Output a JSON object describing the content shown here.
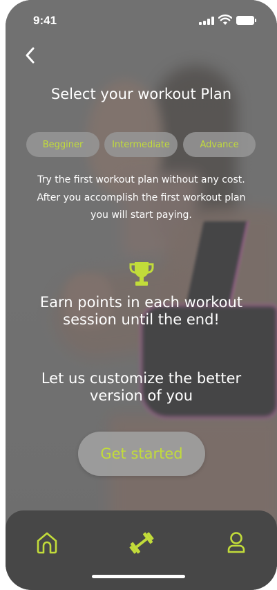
{
  "status_bar": {
    "time": "9:41"
  },
  "header": {
    "title": "Select your workout Plan"
  },
  "plan_tabs": [
    {
      "label": "Begginer"
    },
    {
      "label": "Intermediate"
    },
    {
      "label": "Advance"
    }
  ],
  "description": {
    "line1": "Try the first workout plan without any cost.",
    "line2": "After you accomplish the first workout plan",
    "line3": "you will start paying."
  },
  "reward": {
    "icon": "trophy-icon",
    "line1": "Earn points in each workout",
    "line2": "session until the end!"
  },
  "customize": {
    "line1": "Let us customize the better",
    "line2": "version of you"
  },
  "cta": {
    "label": "Get started"
  },
  "bottom_nav": [
    {
      "icon": "home-icon"
    },
    {
      "icon": "dumbbell-icon"
    },
    {
      "icon": "profile-icon"
    }
  ],
  "colors": {
    "accent": "#c2dc3a",
    "tabbar": "#474747",
    "overlay": "#737373"
  }
}
